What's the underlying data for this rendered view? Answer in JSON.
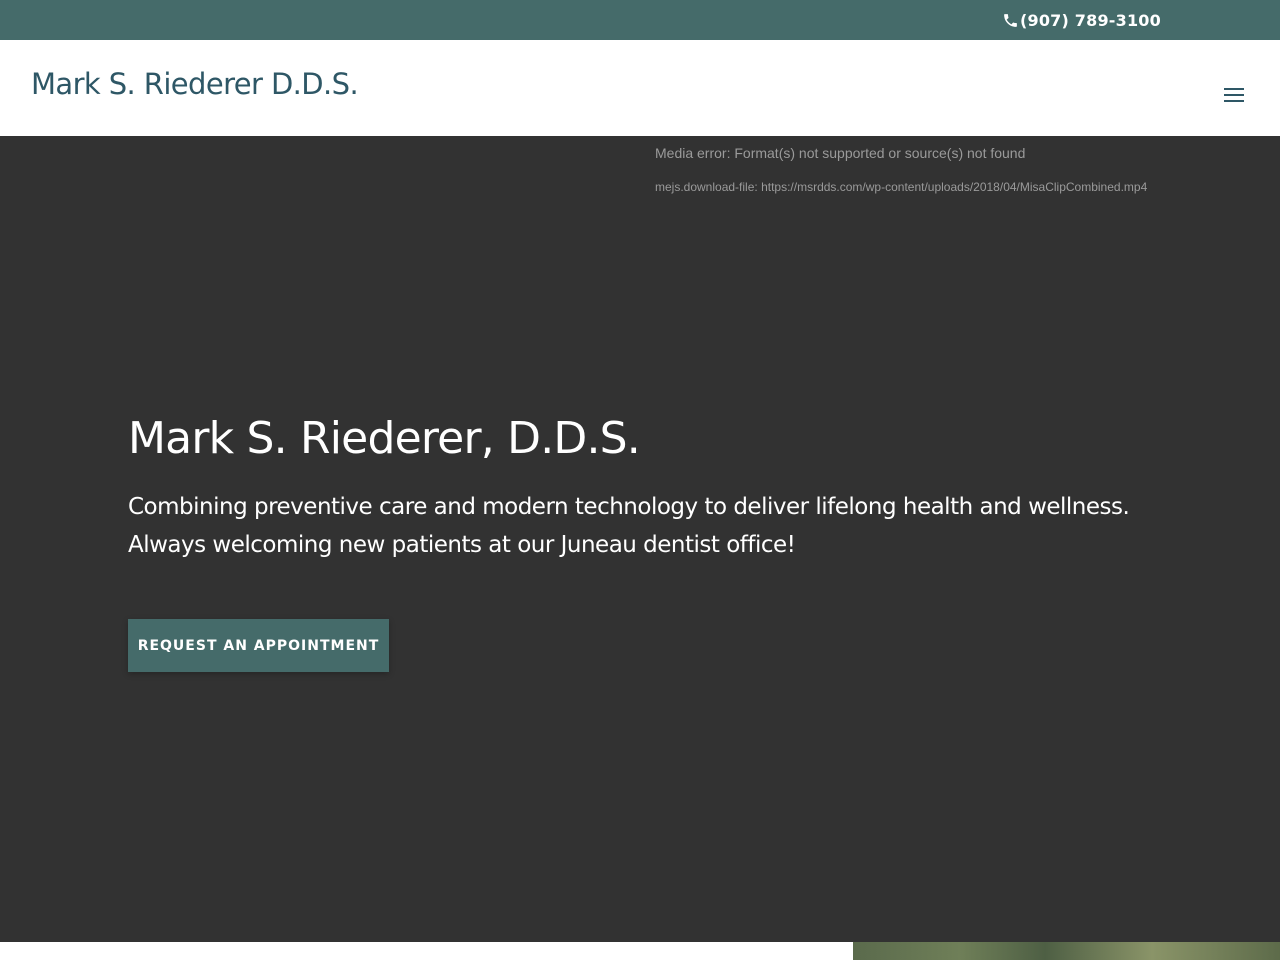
{
  "topbar": {
    "phone": "(907) 789-3100",
    "phone_icon": "phone-icon",
    "background": "#456b6a"
  },
  "header": {
    "logo": "Mark S. Riederer D.D.S.",
    "logo_color": "#2e5766",
    "menu_icon": "hamburger-menu-icon"
  },
  "hero": {
    "media_error": "Media error: Format(s) not supported or source(s) not found",
    "download_label": "mejs.download-file: ",
    "download_url": "https://msrdds.com/wp-content/uploads/2018/04/MisaClipCombined.mp4",
    "title": "Mark S. Riederer, D.D.S.",
    "subtitle_line1": "Combining preventive care and modern technology to deliver lifelong health and wellness.",
    "subtitle_line2": "Always welcoming new patients at our Juneau dentist office!",
    "cta_label": "Request an Appointment",
    "background": "#323232",
    "accent": "#456b6a"
  }
}
